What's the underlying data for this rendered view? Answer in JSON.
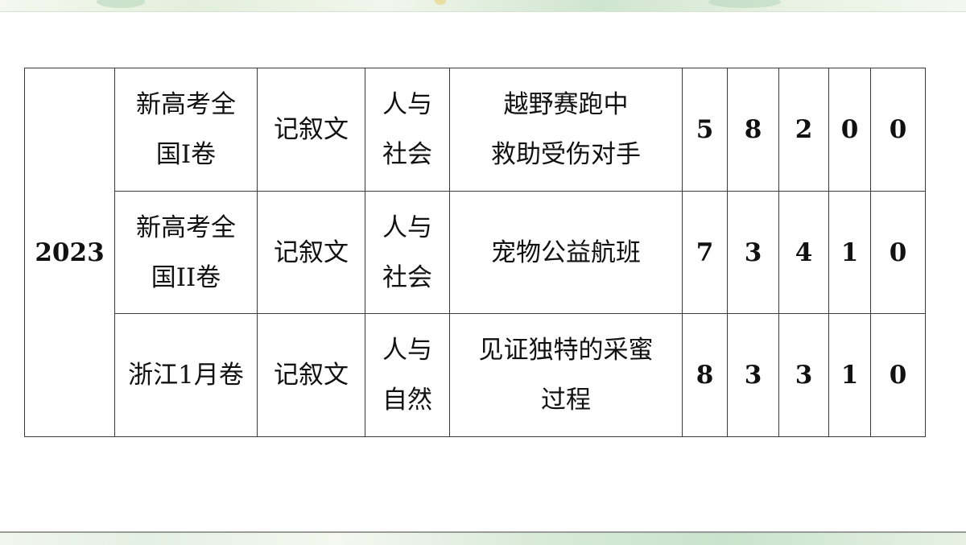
{
  "table": {
    "year": "2023",
    "rows": [
      {
        "paper": [
          "新高考全",
          "国I卷"
        ],
        "genre": "记叙文",
        "theme": [
          "人与",
          "社会"
        ],
        "topic": [
          "越野赛跑中",
          "救助受伤对手"
        ],
        "counts": [
          "5",
          "8",
          "2",
          "0",
          "0"
        ]
      },
      {
        "paper": [
          "新高考全",
          "国II卷"
        ],
        "genre": "记叙文",
        "theme": [
          "人与",
          "社会"
        ],
        "topic": [
          "宠物公益航班"
        ],
        "counts": [
          "7",
          "3",
          "4",
          "1",
          "0"
        ]
      },
      {
        "paper": [
          "浙江1月卷"
        ],
        "genre": "记叙文",
        "theme": [
          "人与",
          "自然"
        ],
        "topic": [
          "见证独特的采蜜",
          "过程"
        ],
        "counts": [
          "8",
          "3",
          "3",
          "1",
          "0"
        ]
      }
    ]
  },
  "colors": {
    "border": "#3a3a3a",
    "text": "#111111",
    "decor_green": "#cfe5cf"
  }
}
